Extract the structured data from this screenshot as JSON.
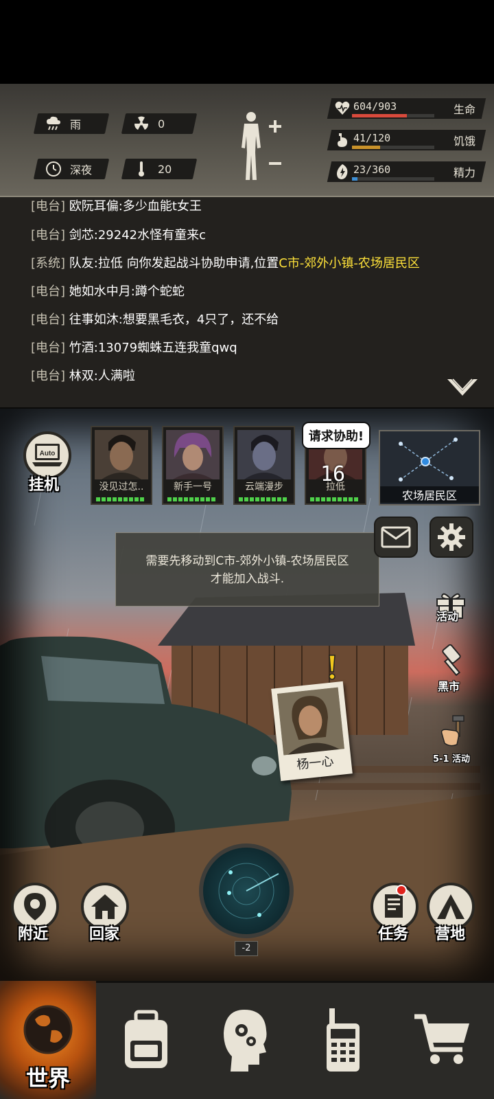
{
  "status": {
    "weather": "雨",
    "radiation": "0",
    "time_of_day": "深夜",
    "temperature": "20",
    "stats": [
      {
        "label": "生命",
        "value": "604/903",
        "fraction": 0.669,
        "color": "#d94a3c",
        "icon": "heart-icon"
      },
      {
        "label": "饥饿",
        "value": "41/120",
        "fraction": 0.342,
        "color": "#c9922a",
        "icon": "stomach-icon"
      },
      {
        "label": "精力",
        "value": "23/360",
        "fraction": 0.064,
        "color": "#3d8fd6",
        "icon": "energy-icon"
      }
    ]
  },
  "chat": {
    "lines": [
      {
        "tag": "[电台]",
        "name": "欧阮耳偏",
        "msg": ":多少血能t女王",
        "loc": ""
      },
      {
        "tag": "[电台]",
        "name": "剑芯",
        "msg": ":29242水怪有童来c",
        "loc": ""
      },
      {
        "tag": "[系统]",
        "name": "队友",
        "msg": ":拉低 向你发起战斗协助申请,位置",
        "loc": "C市-郊外小镇-农场居民区"
      },
      {
        "tag": "[电台]",
        "name": "她如水中月",
        "msg": ":蹲个蛇蛇",
        "loc": ""
      },
      {
        "tag": "[电台]",
        "name": "往事如沐",
        "msg": ":想要黑毛衣，4只了，还不给",
        "loc": ""
      },
      {
        "tag": "[电台]",
        "name": "竹酒",
        "msg": ":13079蜘蛛五连我童qwq",
        "loc": ""
      },
      {
        "tag": "[电台]",
        "name": "林双",
        "msg": ":人满啦",
        "loc": ""
      }
    ]
  },
  "scene": {
    "auto_label": "Auto",
    "idle_label": "挂机",
    "team": [
      {
        "name": "没见过怎..",
        "hp_pips": 9
      },
      {
        "name": "新手一号",
        "hp_pips": 9
      },
      {
        "name": "云端漫步",
        "hp_pips": 9
      },
      {
        "name": "拉低",
        "hp_pips": 9
      }
    ],
    "assist_bubble": "请求协助!",
    "assist_count": "16",
    "map_location": "农场居民区",
    "notice_line1": "需要先移动到C市-郊外小镇-农场居民区",
    "notice_line2": "才能加入战斗.",
    "side": {
      "event": "活动",
      "black_market": "黑市",
      "labor_day": "5-1 活动"
    },
    "npc_name": "杨一心",
    "radar_level": "-2",
    "bottom": {
      "nearby": "附近",
      "home": "回家",
      "tasks": "任务",
      "camp": "营地"
    }
  },
  "nav": {
    "world": "世界"
  },
  "colors": {
    "hp": "#d94a3c",
    "hunger": "#c9922a",
    "energy": "#3d8fd6",
    "location_highlight": "#ffe23a",
    "active_tab": "#f08a24"
  }
}
